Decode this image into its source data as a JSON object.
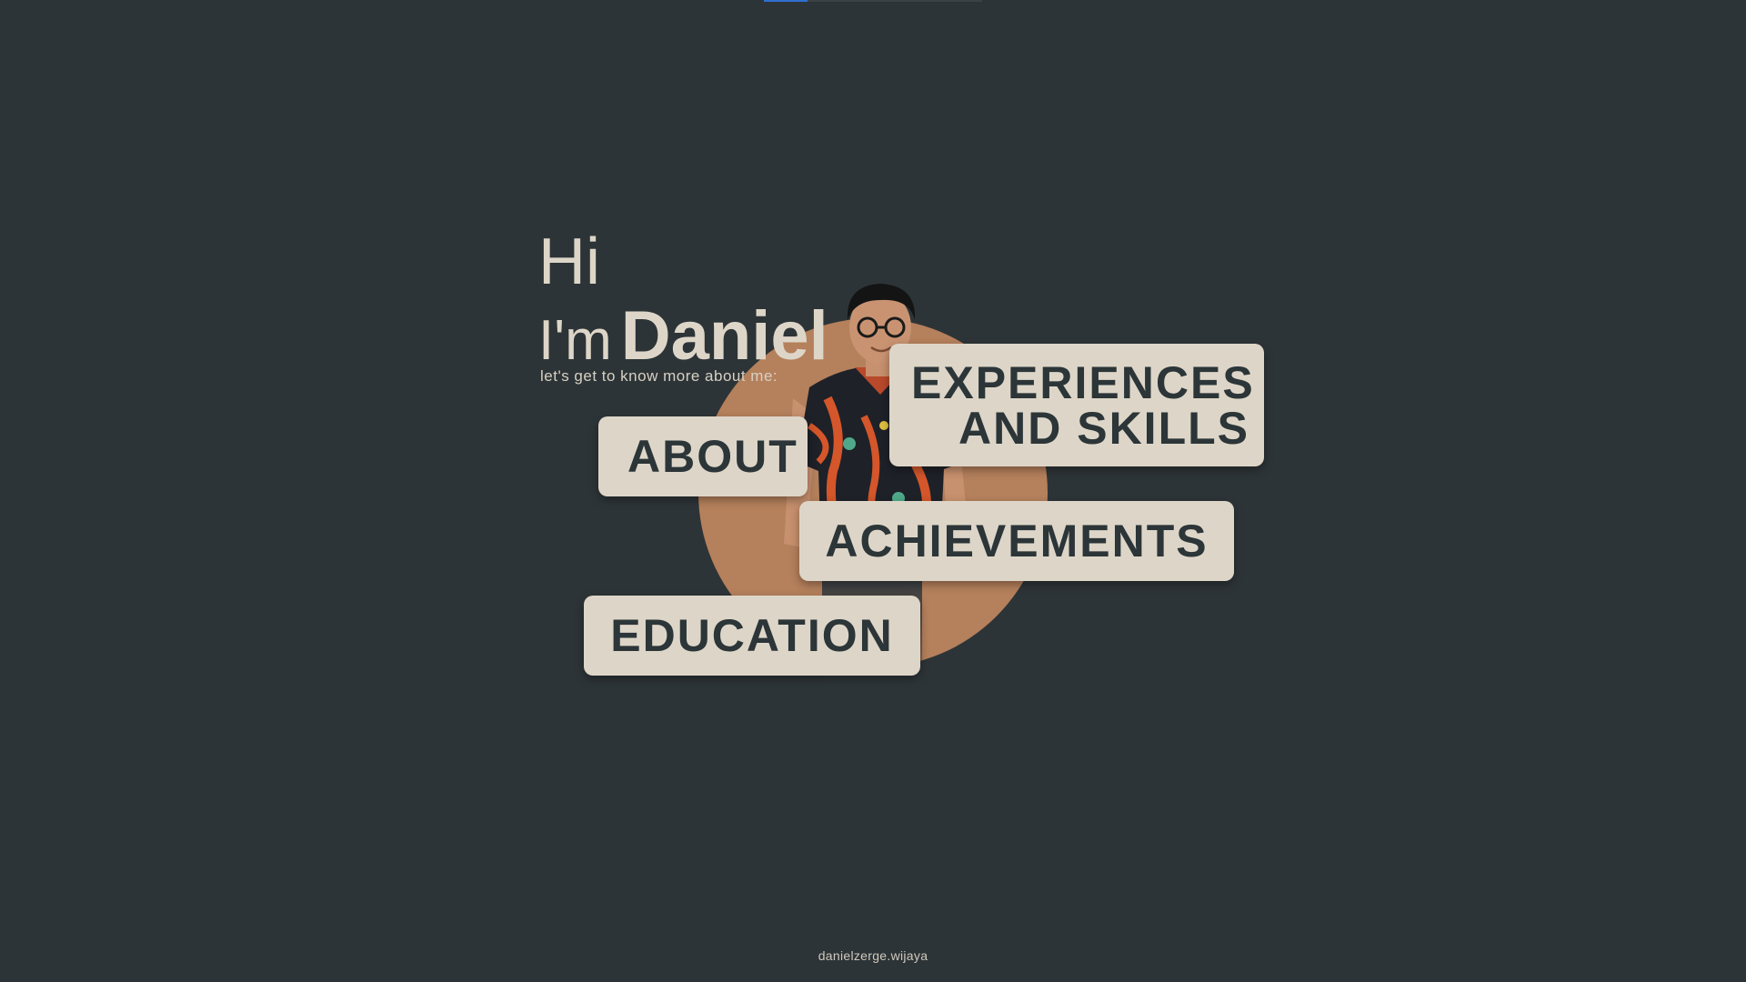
{
  "hero": {
    "hi": "Hi",
    "im": "I'm",
    "name": "Daniel",
    "subtitle": "let's get to know more about me:"
  },
  "nav": {
    "about": "ABOUT",
    "experiences_line1": "EXPERIENCES",
    "experiences_line2": "AND SKILLS",
    "achievements": "ACHIEVEMENTS",
    "education": "EDUCATION"
  },
  "footer": {
    "handle": "danielzerge.wijaya"
  },
  "colors": {
    "background": "#2d3437",
    "card": "#ddd6c8",
    "card_text": "#2c3538",
    "accent_circle": "#b5805c",
    "indicator_active": "#2f6fd0"
  },
  "icons": [
    "person-photo"
  ]
}
